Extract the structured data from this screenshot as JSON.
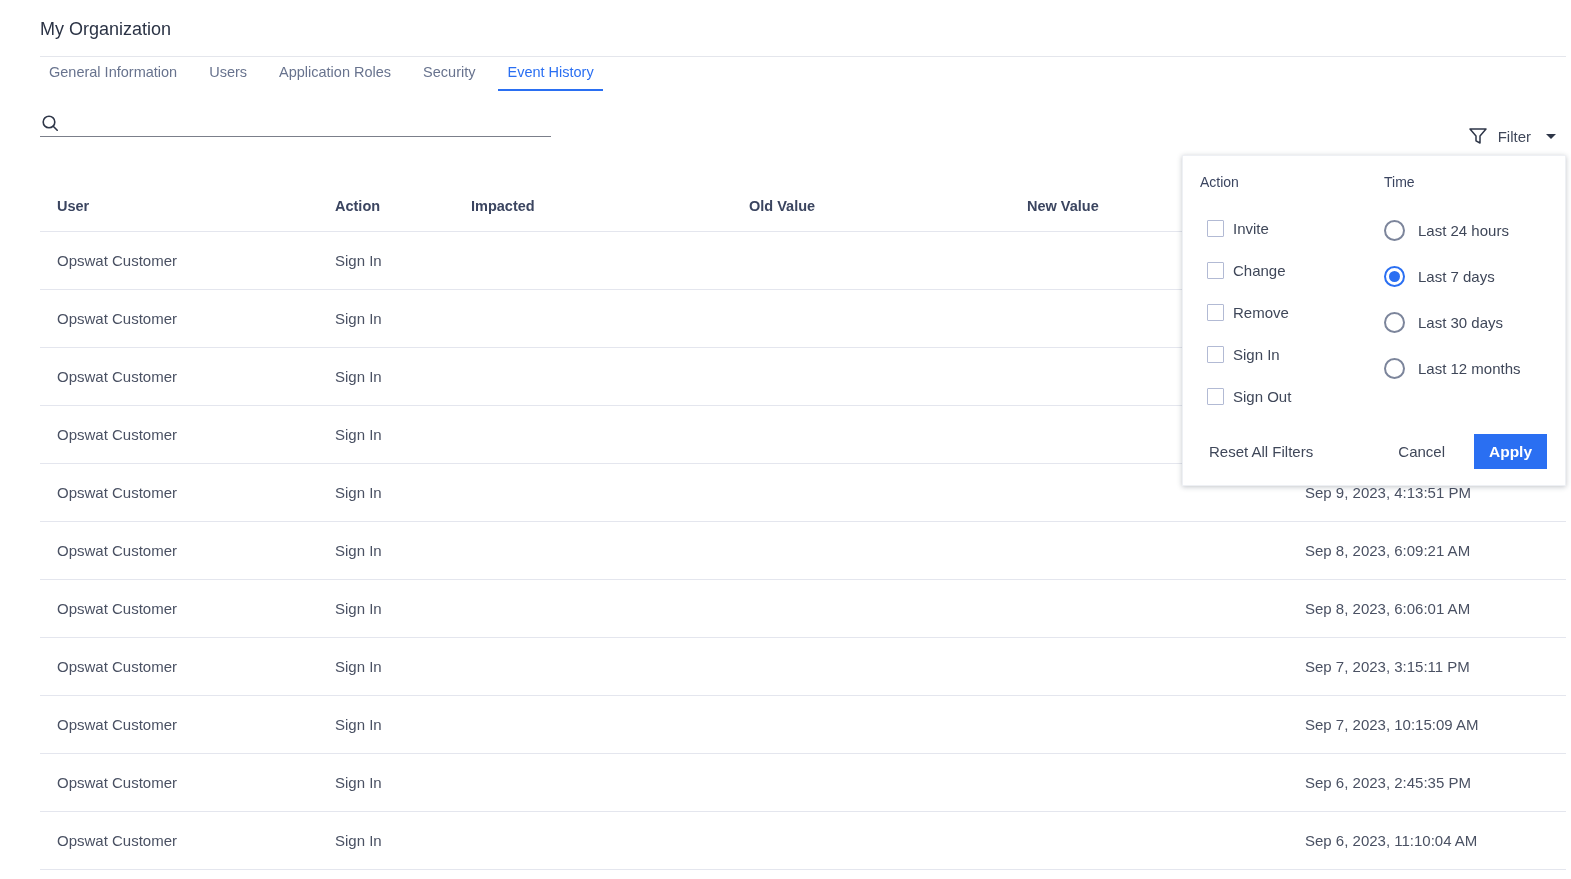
{
  "page": {
    "title": "My Organization"
  },
  "tabs": [
    {
      "label": "General Information",
      "selected": false
    },
    {
      "label": "Users",
      "selected": false
    },
    {
      "label": "Application Roles",
      "selected": false
    },
    {
      "label": "Security",
      "selected": false
    },
    {
      "label": "Event History",
      "selected": true
    }
  ],
  "filter_button": {
    "label": "Filter",
    "expanded": true
  },
  "table": {
    "columns": [
      "User",
      "Action",
      "Impacted",
      "Old Value",
      "New Value"
    ],
    "rows": [
      {
        "user": "Opswat Customer",
        "action": "Sign In"
      },
      {
        "user": "Opswat Customer",
        "action": "Sign In"
      },
      {
        "user": "Opswat Customer",
        "action": "Sign In"
      },
      {
        "user": "Opswat Customer",
        "action": "Sign In"
      },
      {
        "user": "Opswat Customer",
        "action": "Sign In",
        "column_6": "Sep 9, 2023, 4:13:51 PM"
      },
      {
        "user": "Opswat Customer",
        "action": "Sign In",
        "column_6": "Sep 8, 2023, 6:09:21 AM"
      },
      {
        "user": "Opswat Customer",
        "action": "Sign In",
        "column_6": "Sep 8, 2023, 6:06:01 AM"
      },
      {
        "user": "Opswat Customer",
        "action": "Sign In",
        "column_6": "Sep 7, 2023, 3:15:11 PM"
      },
      {
        "user": "Opswat Customer",
        "action": "Sign In",
        "column_6": "Sep 7, 2023, 10:15:09 AM"
      },
      {
        "user": "Opswat Customer",
        "action": "Sign In",
        "column_6": "Sep 6, 2023, 2:45:35 PM"
      },
      {
        "user": "Opswat Customer",
        "action": "Sign In",
        "column_6": "Sep 6, 2023, 11:10:04 AM"
      }
    ]
  },
  "filter_panel": {
    "action_heading": "Action",
    "action_options": [
      {
        "label": "Invite",
        "checked": false
      },
      {
        "label": "Change",
        "checked": false
      },
      {
        "label": "Remove",
        "checked": false
      },
      {
        "label": "Sign In",
        "checked": false
      },
      {
        "label": "Sign Out",
        "checked": false
      }
    ],
    "time_heading": "Time",
    "time_options": [
      {
        "label": "Last 24 hours",
        "selected": false
      },
      {
        "label": "Last 7 days",
        "selected": true
      },
      {
        "label": "Last 30 days",
        "selected": false
      },
      {
        "label": "Last 12 months",
        "selected": false
      }
    ],
    "reset_label": "Reset All Filters",
    "cancel_label": "Cancel",
    "apply_label": "Apply"
  }
}
